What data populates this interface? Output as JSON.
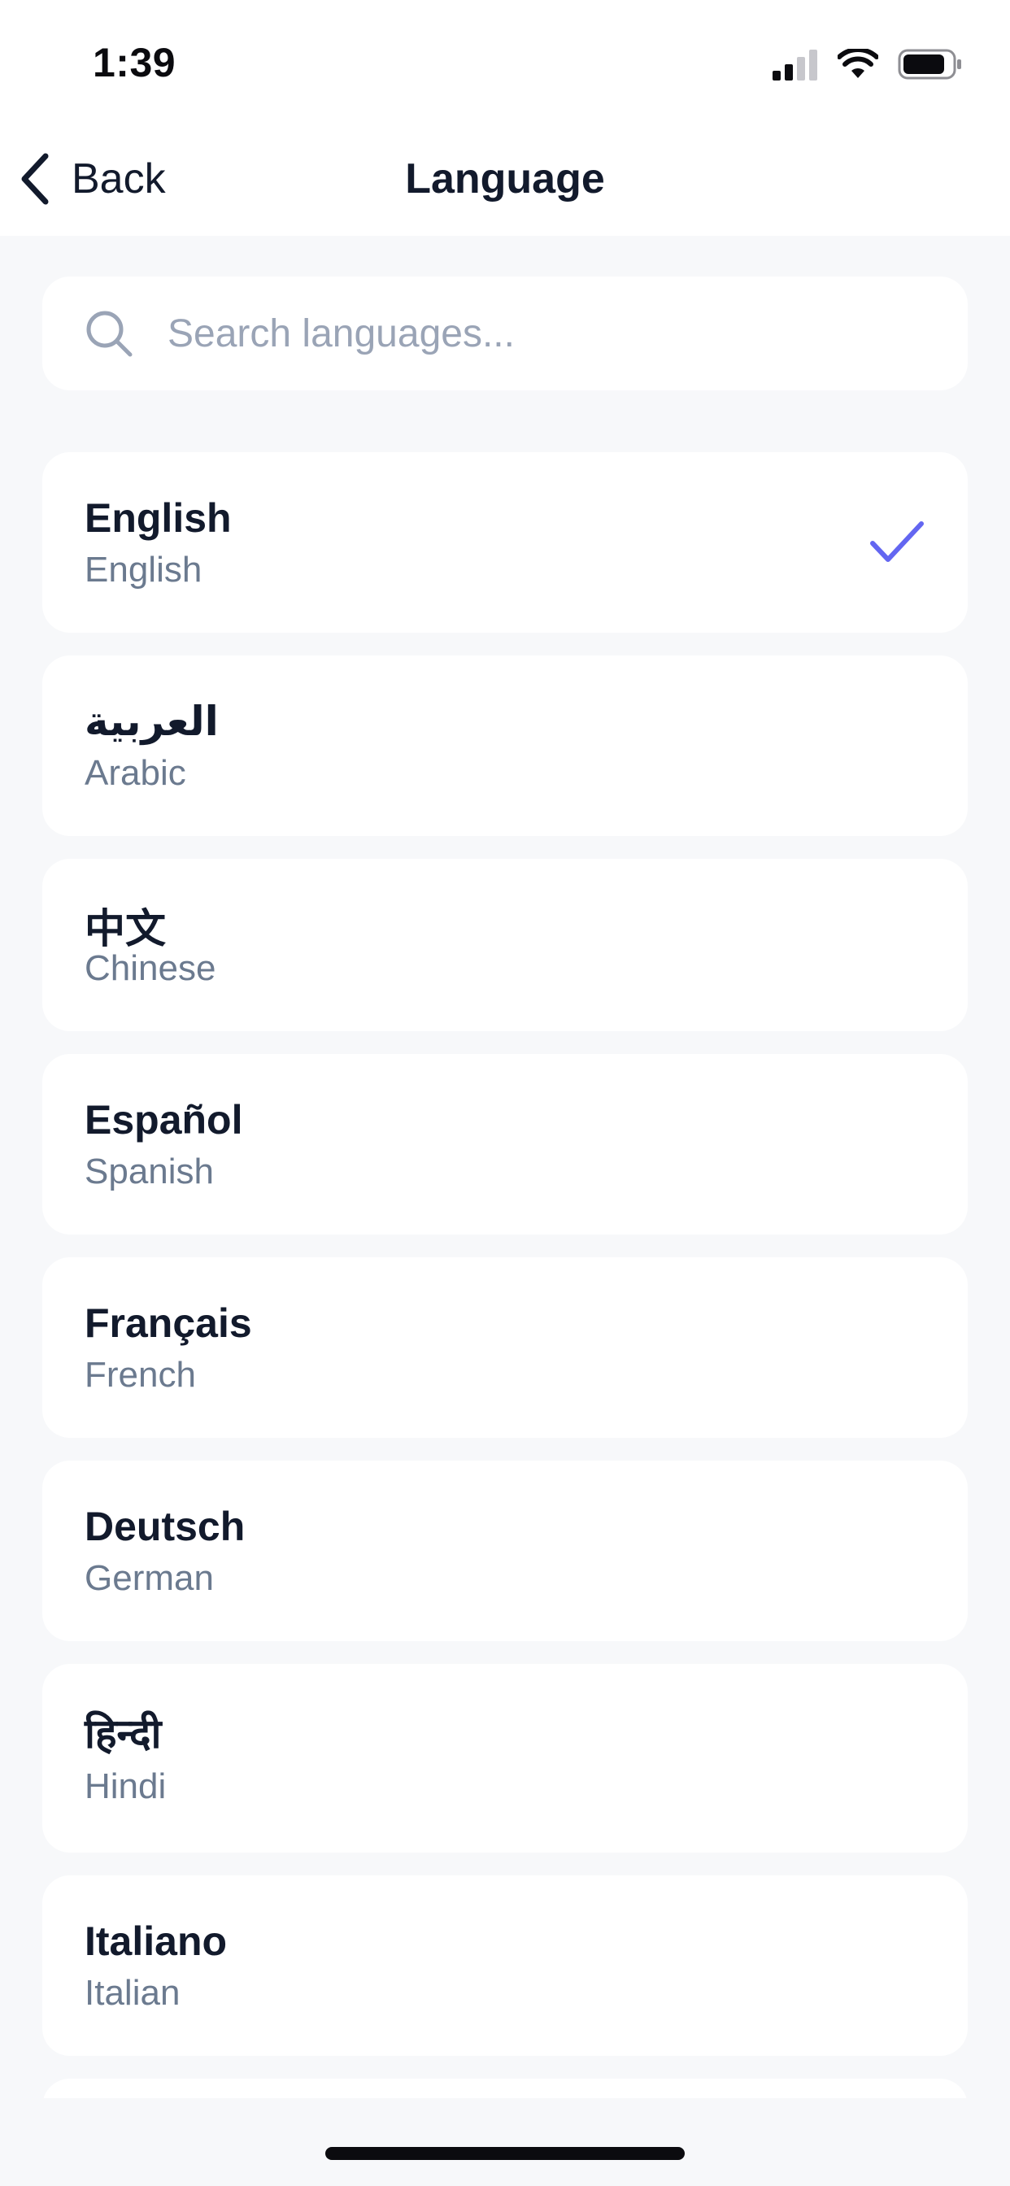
{
  "status_bar": {
    "time": "1:39"
  },
  "nav": {
    "back_label": "Back",
    "title": "Language"
  },
  "search": {
    "placeholder": "Search languages...",
    "value": ""
  },
  "languages": [
    {
      "native": "English",
      "english": "English",
      "selected": true
    },
    {
      "native": "العربية",
      "english": "Arabic",
      "selected": false
    },
    {
      "native": "中文",
      "english": "Chinese",
      "selected": false
    },
    {
      "native": "Español",
      "english": "Spanish",
      "selected": false
    },
    {
      "native": "Français",
      "english": "French",
      "selected": false
    },
    {
      "native": "Deutsch",
      "english": "German",
      "selected": false
    },
    {
      "native": "हिन्दी",
      "english": "Hindi",
      "selected": false
    },
    {
      "native": "Italiano",
      "english": "Italian",
      "selected": false
    }
  ],
  "colors": {
    "accent": "#6366f1",
    "background": "#f7f8fa",
    "card": "#ffffff",
    "primary_text": "#121a2c",
    "secondary_text": "#6b7a8f",
    "placeholder": "#9aa4b6"
  },
  "icons": {
    "back": "chevron-left-icon",
    "search": "search-icon",
    "selected": "check-icon",
    "signal": "cellular-signal-icon",
    "wifi": "wifi-icon",
    "battery": "battery-icon"
  }
}
